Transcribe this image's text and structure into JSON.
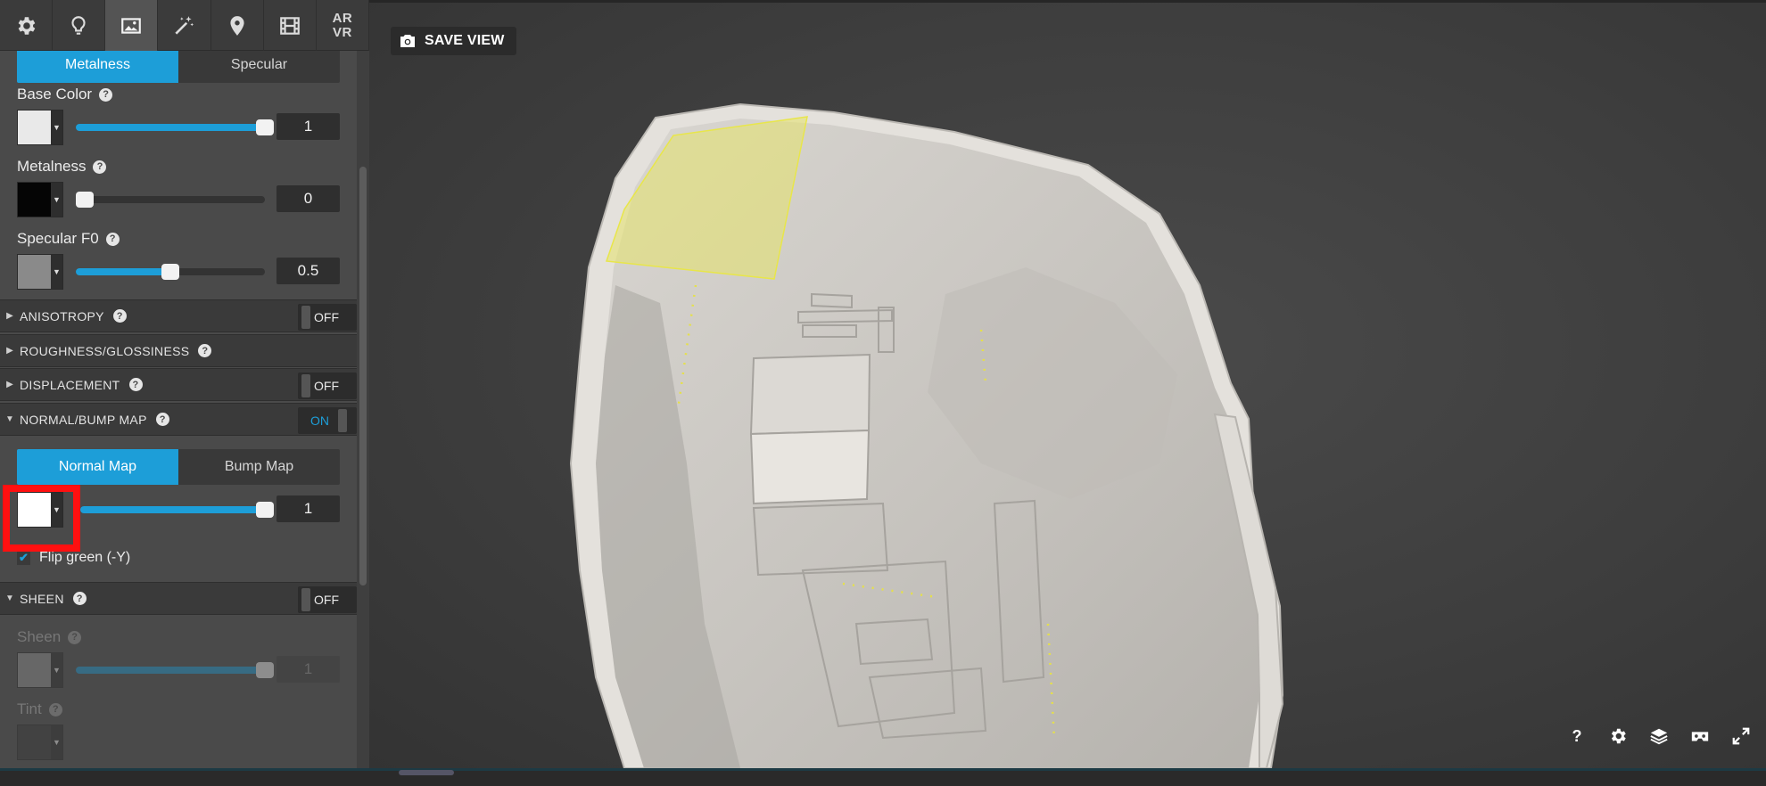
{
  "toolbar": {
    "tools": [
      {
        "icon": "gear-icon"
      },
      {
        "icon": "lightbulb-icon"
      },
      {
        "icon": "image-icon",
        "active": true
      },
      {
        "icon": "magic-wand-icon"
      },
      {
        "icon": "map-pin-icon"
      },
      {
        "icon": "film-icon"
      },
      {
        "icon": "ar-vr-icon",
        "label_line1": "AR",
        "label_line2": "VR"
      }
    ]
  },
  "pbr_tabs": {
    "metalness": "Metalness",
    "specular": "Specular"
  },
  "base_color": {
    "label": "Base Color",
    "value": "1",
    "level": 1.0,
    "swatch_color": "#e9e9e9"
  },
  "metalness": {
    "label": "Metalness",
    "value": "0",
    "level": 0.0,
    "swatch_color": "#050505"
  },
  "specular_f0": {
    "label": "Specular F0",
    "value": "0.5",
    "level": 0.5,
    "swatch_color": "#8a8a8a"
  },
  "sections": {
    "anisotropy": {
      "label": "ANISOTROPY",
      "state": "OFF"
    },
    "roughness": {
      "label": "ROUGHNESS/GLOSSINESS"
    },
    "displacement": {
      "label": "DISPLACEMENT",
      "state": "OFF"
    },
    "normal_bump": {
      "label": "NORMAL/BUMP MAP",
      "state": "ON"
    },
    "sheen": {
      "label": "SHEEN",
      "state": "OFF"
    }
  },
  "normal_tabs": {
    "normal_map": "Normal Map",
    "bump_map": "Bump Map"
  },
  "normal_map": {
    "value": "1",
    "level": 1.0,
    "swatch_color": "#ffffff"
  },
  "flip_green": {
    "label": "Flip green (-Y)",
    "checked": true
  },
  "sheen": {
    "label": "Sheen",
    "value": "1",
    "level": 1.0
  },
  "tint": {
    "label": "Tint"
  },
  "viewport": {
    "save_view_label": "SAVE VIEW"
  },
  "viewport_controls": [
    "help-icon",
    "settings-icon",
    "layers-icon",
    "vr-headset-icon",
    "fullscreen-icon"
  ],
  "colors": {
    "accent": "#1d9ed8",
    "highlight": "#ff1010",
    "selection_overlay": "#e5e36a"
  }
}
